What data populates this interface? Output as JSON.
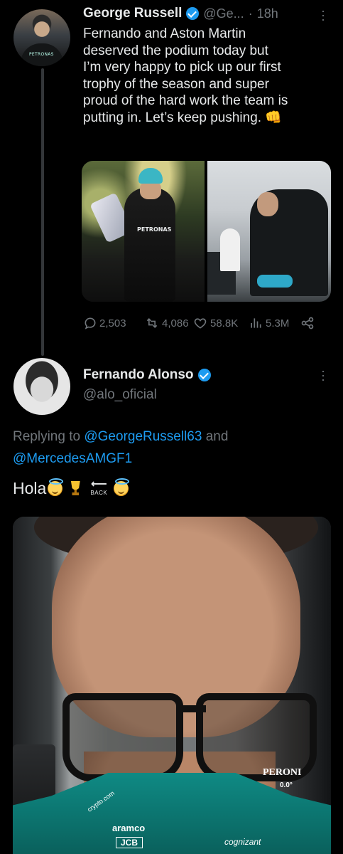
{
  "tweet1": {
    "author_name": "George Russell",
    "handle_truncated": "@Ge...",
    "separator": "·",
    "time": "18h",
    "text_lines": [
      "Fernando and Aston Martin",
      "deserved the podium today but",
      "I’m very happy to pick up our first",
      "trophy of the season and super",
      "proud of the hard work the team is",
      "putting in. Let’s keep pushing. 👊"
    ],
    "media_left_text": "PETRONAS",
    "avatar_text": "PETRONAS",
    "stats": {
      "replies": "2,503",
      "reposts": "4,086",
      "likes": "58.8K",
      "views": "5.3M"
    }
  },
  "tweet2": {
    "author_name": "Fernando Alonso",
    "handle": "@alo_oficial",
    "replying_prefix": "Replying to ",
    "replying_to_1": "@GeorgeRussell63",
    "replying_join": " and",
    "replying_to_2": "@MercedesAMGF1",
    "text": "Hola",
    "back_label": "BACK",
    "photo_sponsors": {
      "peroni": "PERONI",
      "peroni_sub": "0.0°",
      "crypto": "crypto.com",
      "aramco": "aramco",
      "jcb": "JCB",
      "cognizant": "cognizant"
    }
  },
  "colors": {
    "background": "#000000",
    "text": "#e7e9ea",
    "muted": "#71767b",
    "accent": "#1d9bf0"
  }
}
